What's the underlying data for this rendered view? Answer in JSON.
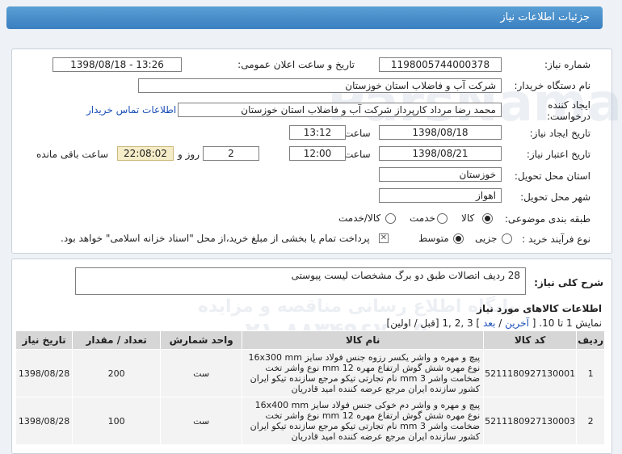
{
  "header": {
    "title": "جزئیات اطلاعات نیاز"
  },
  "form": {
    "need_number_label": "شماره نیاز:",
    "need_number": "1198005744000378",
    "announce_label": "تاریخ و ساعت اعلان عمومی:",
    "announce_value": "1398/08/18 - 13:26",
    "buyer_label": "نام دستگاه خریدار:",
    "buyer_value": "شرکت آب و فاضلاب استان خوزستان",
    "creator_label_1": "ایجاد کننده",
    "creator_label_2": "درخواست:",
    "creator_value": "محمد رضا مرداد کارپرداز شرکت آب و فاضلاب استان خوزستان",
    "contact_link": "اطلاعات تماس خریدار",
    "create_date_label": "تاریخ ایجاد نیاز:",
    "create_date": "1398/08/18",
    "time_label": "ساعت",
    "create_time": "13:12",
    "valid_date_label": "تاریخ اعتبار نیاز:",
    "valid_date": "1398/08/21",
    "valid_time": "12:00",
    "days_value": "2",
    "days_label": "روز و",
    "remaining_value": "22:08:02",
    "remaining_label": "ساعت باقی مانده",
    "province_label": "استان محل تحویل:",
    "province_value": "خوزستان",
    "city_label": "شهر محل تحویل:",
    "city_value": "اهواز",
    "category_label": "طبقه بندی موضوعی:",
    "category_options": [
      "کالا",
      "خدمت",
      "کالا/خدمت"
    ],
    "category_selected": "کالا",
    "purchase_label": "نوع فرآیند خرید :",
    "purchase_options": [
      "جزیی",
      "متوسط"
    ],
    "purchase_selected": "متوسط",
    "payment_note": "پرداخت تمام یا بخشی از مبلغ خرید،از محل \"اسناد خزانه اسلامی\" خواهد بود."
  },
  "summary": {
    "label": "شرح کلی نیاز:",
    "value": "28 ردیف اتصالات طبق دو برگ مشخصات لیست پیوستی"
  },
  "items_section": {
    "title": "اطلاعات کالاهای مورد نیاز",
    "pagination": {
      "prefix": "نمایش 1 تا 10. [",
      "last": "آخرین",
      "sep1": " / ",
      "next": "بعد",
      "pages": "] 3 ,2 ,1",
      "tail": " [قبل / اولین]"
    },
    "columns": [
      "ردیف",
      "کد کالا",
      "نام کالا",
      "واحد شمارش",
      "تعداد / مقدار",
      "تاریخ نیاز"
    ],
    "rows": [
      {
        "index": "1",
        "code": "5211180927130001",
        "name_lines": [
          "پیچ و مهره و واشر یکسر رزوه جنس فولاد سایز 16x300 mm",
          "نوع مهره شش گوش ارتفاع مهره 12 mm نوع واشر تخت",
          "ضخامت واشر 3 mm نام تجارتی تیکو مرجع سازنده تیکو ایران",
          "کشور سازنده ایران مرجع عرضه کننده امید قادریان"
        ],
        "unit": "ست",
        "qty": "200",
        "date": "1398/08/28"
      },
      {
        "index": "2",
        "code": "5211180927130003",
        "name_lines": [
          "پیچ و مهره و واشر دم خوکی جنس فولاد سایز 16x400 mm",
          "نوع مهره شش گوش ارتفاع مهره 12 mm نوع واشر تخت",
          "ضخامت واشر 3 mm نام تجارتی تیکو مرجع سازنده تیکو ایران",
          "کشور سازنده ایران مرجع عرضه کننده امید قادریان"
        ],
        "unit": "ست",
        "qty": "100",
        "date": "1398/08/28"
      }
    ]
  }
}
